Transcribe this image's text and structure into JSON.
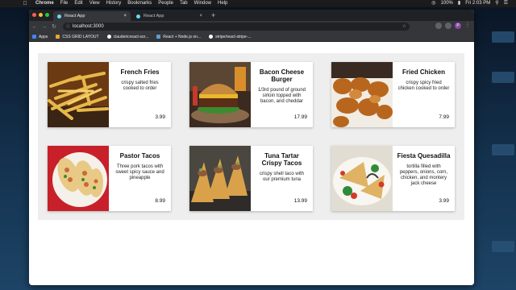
{
  "os_menubar": {
    "items": [
      "Chrome",
      "File",
      "Edit",
      "View",
      "History",
      "Bookmarks",
      "People",
      "Tab",
      "Window",
      "Help"
    ],
    "battery": "100%",
    "clock": "Fri 2:03 PM"
  },
  "browser": {
    "tabs": [
      {
        "label": "React App"
      },
      {
        "label": "React App"
      }
    ],
    "url": "localhost:3000",
    "profile_initial": "P",
    "bookmarks": [
      "Apps",
      "CSS GRID LAYOUT",
      "claudericreact-sor...",
      "React + Node.js on...",
      "stripe/react-stripe-..."
    ]
  },
  "menu": [
    {
      "title": "French Fries",
      "description": "crispy salted fries cooked to order",
      "price": "3.99"
    },
    {
      "title": "Bacon Cheese Burger",
      "description": "1/3rd pound of ground sirloin topped with bacon, and cheddar",
      "price": "17.99"
    },
    {
      "title": "Fried Chicken",
      "description": "crispy spicy fried chicken cooked to order",
      "price": "7.99"
    },
    {
      "title": "Pastor Tacos",
      "description": "Three pork tacos with sweet spicy sauce and pineapple",
      "price": "8.99"
    },
    {
      "title": "Tuna Tartar Crispy Tacos",
      "description": "crispy shell taco with our premium tuna",
      "price": "13.99"
    },
    {
      "title": "Fiesta Quesadilla",
      "description": "tortilla filled with peppers, onions, corn, chicken, and montery jack cheese",
      "price": "3.99"
    }
  ]
}
